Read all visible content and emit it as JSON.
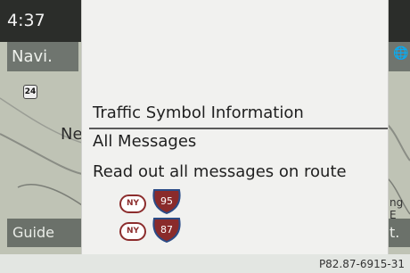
{
  "status": {
    "time": "4:37"
  },
  "left_panel": {
    "navi_label": "Navi.",
    "guide_label": "Guide",
    "map_label": "Ne",
    "route_badge": "24"
  },
  "right_panel": {
    "bottom_label": "t.",
    "map_label": "ng E"
  },
  "menu": {
    "title": "Traffic Symbol Information",
    "items": [
      "All Messages",
      "Read out all messages on route"
    ],
    "routes": [
      {
        "state": "NY",
        "interstate": "95"
      },
      {
        "state": "NY",
        "interstate": "87"
      }
    ]
  },
  "footer": {
    "reference": "P82.87-6915-31"
  },
  "colors": {
    "interstate_red": "#8a2b2b",
    "interstate_blue": "#2b4b86"
  }
}
